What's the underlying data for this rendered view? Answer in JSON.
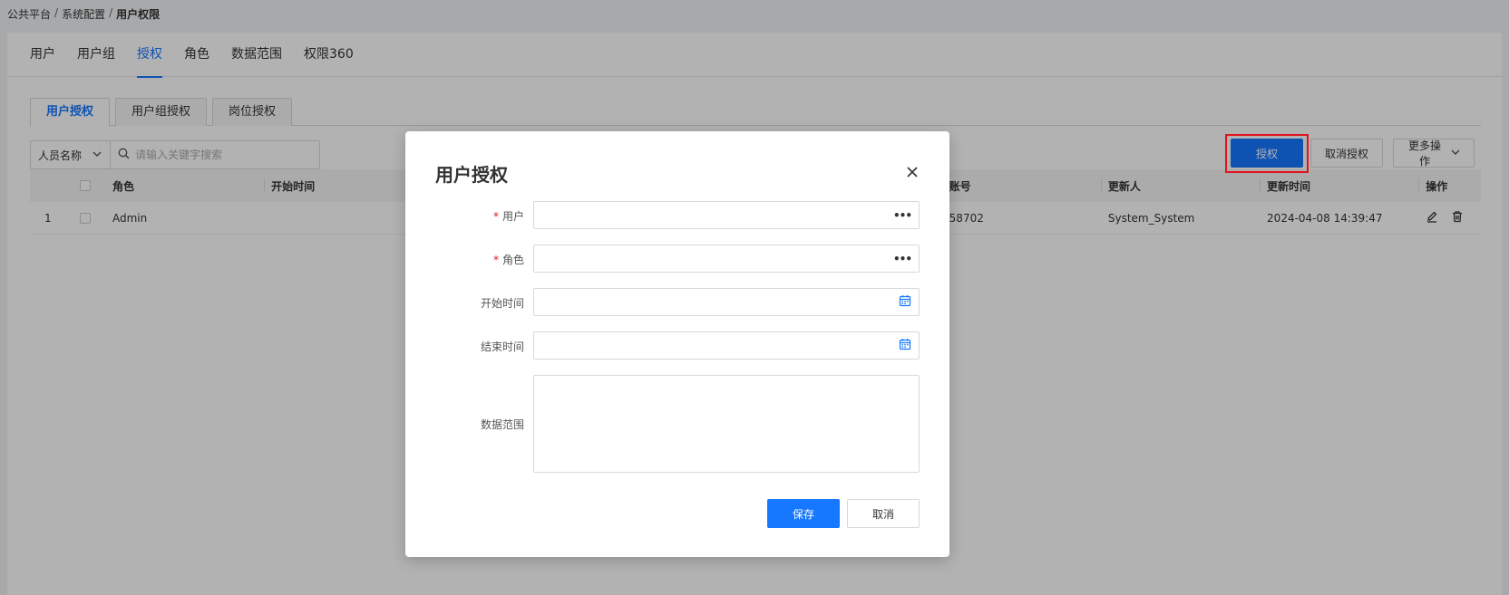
{
  "breadcrumb": {
    "items": [
      "公共平台",
      "系统配置",
      "用户权限"
    ],
    "separator": "/"
  },
  "main_tabs": [
    {
      "label": "用户",
      "active": false
    },
    {
      "label": "用户组",
      "active": false
    },
    {
      "label": "授权",
      "active": true
    },
    {
      "label": "角色",
      "active": false
    },
    {
      "label": "数据范围",
      "active": false
    },
    {
      "label": "权限360",
      "active": false
    }
  ],
  "sub_tabs": [
    {
      "label": "用户授权",
      "active": true
    },
    {
      "label": "用户组授权",
      "active": false
    },
    {
      "label": "岗位授权",
      "active": false
    }
  ],
  "filter": {
    "select_value": "人员名称",
    "search_placeholder": "请输入关键字搜索"
  },
  "toolbar": {
    "grant_label": "授权",
    "ungrant_label": "取消授权",
    "more_label": "更多操作"
  },
  "table": {
    "columns": {
      "role": "角色",
      "start_time": "开始时间",
      "account": "账号",
      "updater": "更新人",
      "update_time": "更新时间",
      "ops": "操作"
    },
    "rows": [
      {
        "index": "1",
        "role": "Admin",
        "account": "58702",
        "updater": "System_System",
        "update_time": "2024-04-08 14:39:47"
      }
    ]
  },
  "modal": {
    "title": "用户授权",
    "fields": {
      "user": {
        "label": "用户",
        "required": true
      },
      "role": {
        "label": "角色",
        "required": true
      },
      "start_time": {
        "label": "开始时间",
        "required": false
      },
      "end_time": {
        "label": "结束时间",
        "required": false
      },
      "data_scope": {
        "label": "数据范围",
        "required": false
      }
    },
    "save_label": "保存",
    "cancel_label": "取消"
  },
  "colors": {
    "primary": "#1677ff",
    "highlight_border": "#e0141e",
    "required": "#e0141e"
  },
  "icons": {
    "close": "close-icon",
    "search": "search-icon",
    "chevron": "chevron-down-icon",
    "calendar": "calendar-icon",
    "edit": "edit-icon",
    "delete": "trash-icon"
  }
}
